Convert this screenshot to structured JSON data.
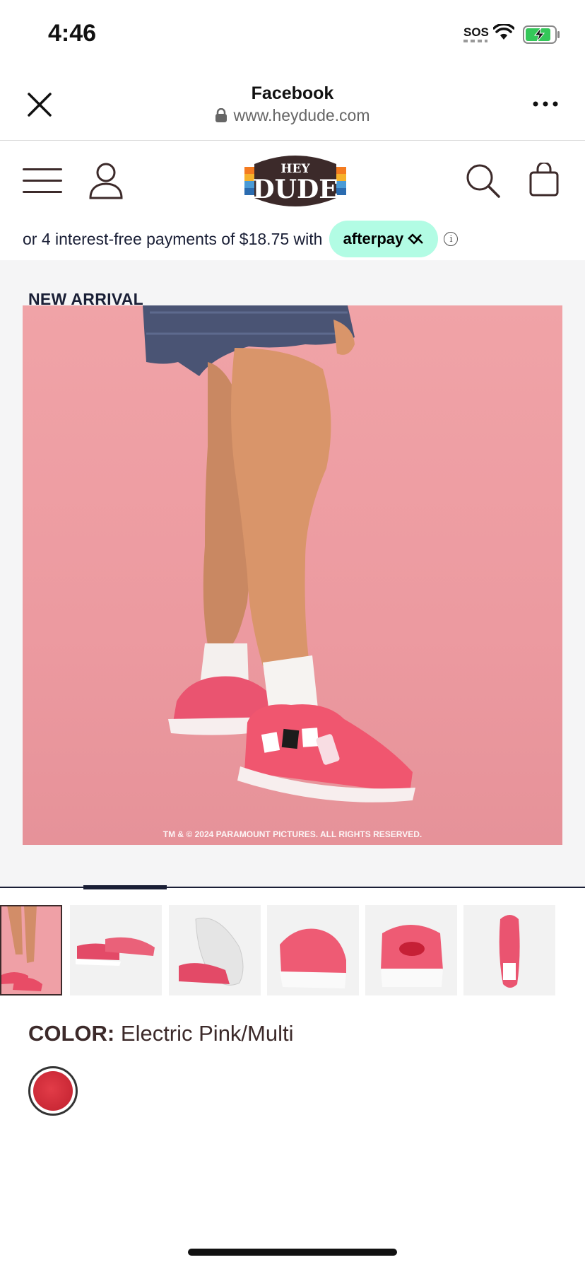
{
  "status_bar": {
    "time": "4:46",
    "sos": "SOS",
    "wifi_icon": "wifi-icon",
    "battery_icon": "battery-charging-icon"
  },
  "browser": {
    "title": "Facebook",
    "url": "www.heydude.com",
    "close_icon": "close-icon",
    "more_icon": "more-icon",
    "lock_icon": "lock-icon"
  },
  "site_header": {
    "menu_icon": "menu-icon",
    "account_icon": "user-icon",
    "logo_text": [
      "HEY",
      "DUDE"
    ],
    "search_icon": "search-icon",
    "bag_icon": "bag-icon"
  },
  "afterpay": {
    "text": "or 4 interest-free payments of $18.75 with",
    "brand": "afterpay",
    "info_icon": "info-icon"
  },
  "product": {
    "badge": "NEW ARRIVAL",
    "image_copyright": "TM & © 2024 PARAMOUNT PICTURES. ALL RIGHTS RESERVED.",
    "thumbnails": [
      "thumb-model-pink",
      "thumb-pair-side",
      "thumb-sole-view",
      "thumb-front-view",
      "thumb-back-view",
      "thumb-top-view"
    ],
    "color_label": "COLOR:",
    "color_value": "Electric Pink/Multi",
    "swatch_color": "#d42d3b"
  },
  "colors": {
    "afterpay_mint": "#b2fce4",
    "brand_brown": "#3c2a2a",
    "hero_pink": "#ec9aa0"
  }
}
